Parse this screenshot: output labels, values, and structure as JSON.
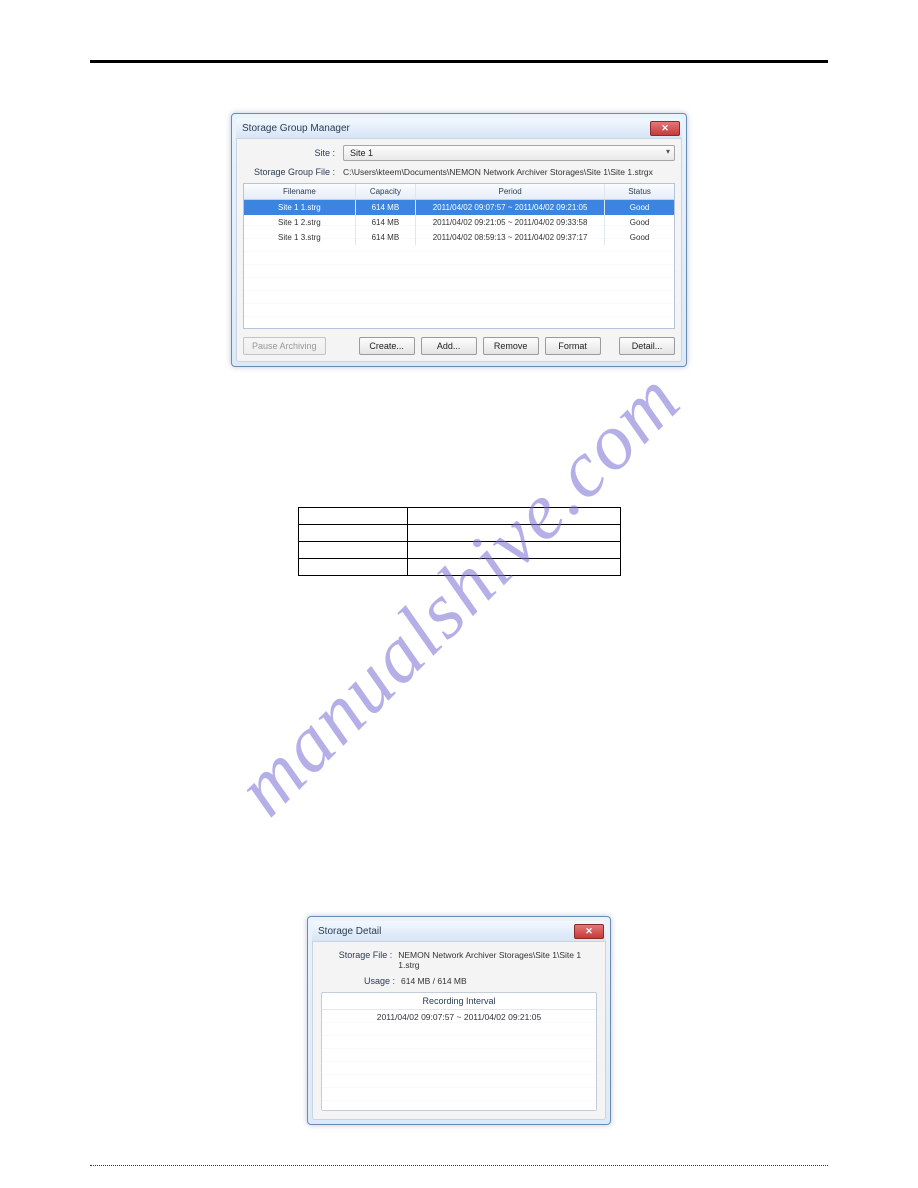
{
  "watermark": "manualshive.com",
  "sgm": {
    "title": "Storage Group Manager",
    "site_label": "Site :",
    "site_value": "Site 1",
    "group_file_label": "Storage Group File :",
    "group_file_value": "C:\\Users\\kteem\\Documents\\NEMON Network Archiver Storages\\Site 1\\Site 1.strgx",
    "cols": {
      "file": "Filename",
      "cap": "Capacity",
      "per": "Period",
      "stat": "Status"
    },
    "rows": [
      {
        "file": "Site 1 1.strg",
        "cap": "614 MB",
        "per": "2011/04/02 09:07:57 ~ 2011/04/02 09:21:05",
        "stat": "Good",
        "selected": true
      },
      {
        "file": "Site 1 2.strg",
        "cap": "614 MB",
        "per": "2011/04/02 09:21:05 ~ 2011/04/02 09:33:58",
        "stat": "Good"
      },
      {
        "file": "Site 1 3.strg",
        "cap": "614 MB",
        "per": "2011/04/02 08:59:13 ~ 2011/04/02 09:37:17",
        "stat": "Good"
      }
    ],
    "buttons": {
      "pause": "Pause Archiving",
      "create": "Create...",
      "add": "Add...",
      "remove": "Remove",
      "format": "Format",
      "detail": "Detail..."
    }
  },
  "sd": {
    "title": "Storage Detail",
    "file_label": "Storage File :",
    "file_value": "NEMON Network Archiver Storages\\Site 1\\Site 1 1.strg",
    "usage_label": "Usage :",
    "usage_value": "614 MB / 614 MB",
    "panel_title": "Recording Interval",
    "interval": "2011/04/02 09:07:57 ~ 2011/04/02 09:21:05"
  }
}
